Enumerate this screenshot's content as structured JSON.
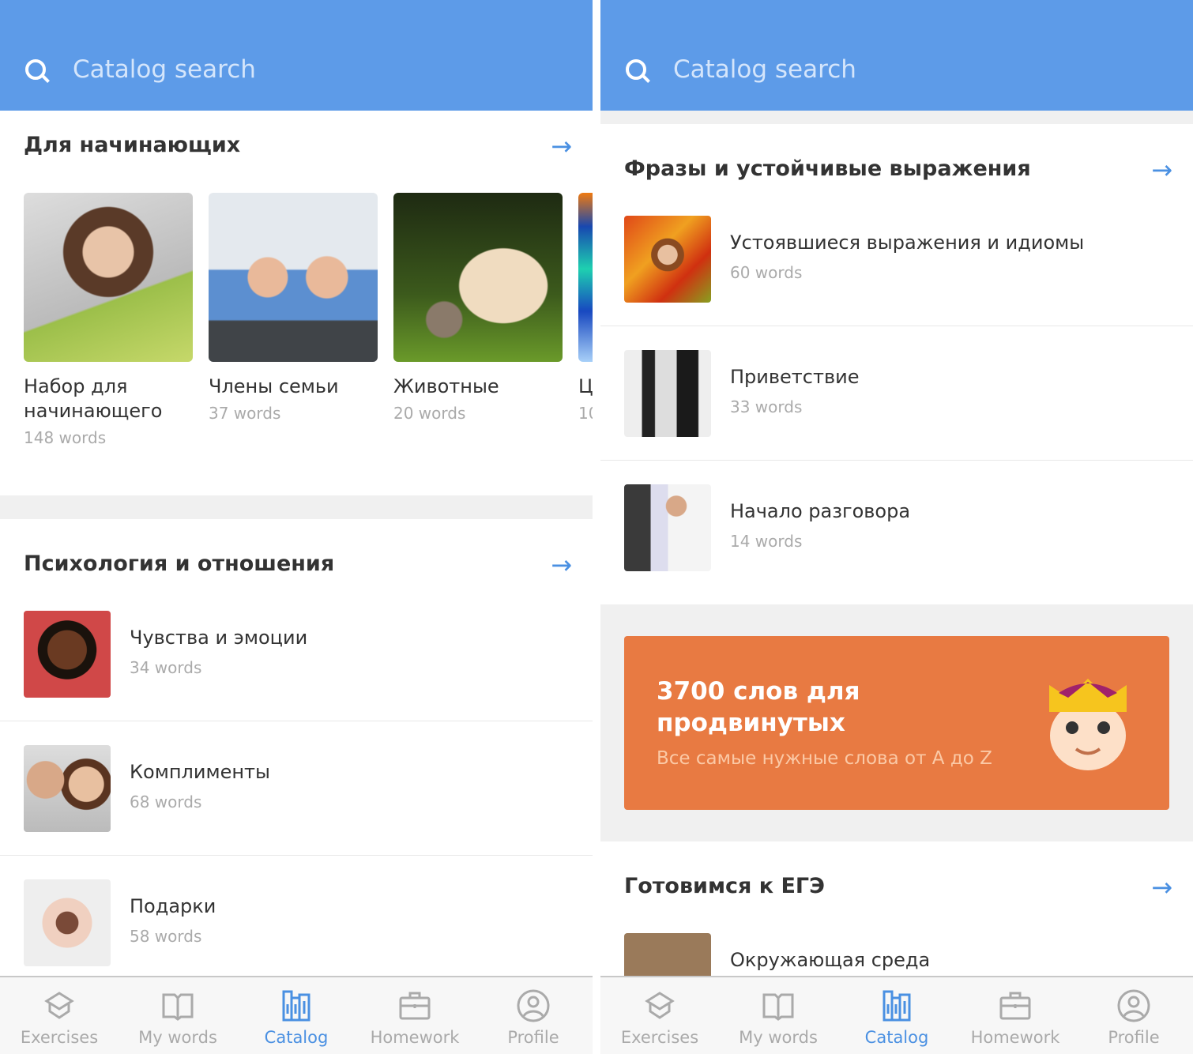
{
  "search": {
    "placeholder": "Catalog search"
  },
  "left": {
    "section1": {
      "title": "Для начинающих",
      "cards": [
        {
          "title": "Набор для начинающего",
          "count": "148 words"
        },
        {
          "title": "Члены семьи",
          "count": "37 words"
        },
        {
          "title": "Животные",
          "count": "20 words"
        },
        {
          "title": "Ц",
          "count": "10"
        }
      ]
    },
    "section2": {
      "title": "Психология и отношения",
      "items": [
        {
          "title": "Чувства и эмоции",
          "count": "34 words"
        },
        {
          "title": "Комплименты",
          "count": "68 words"
        },
        {
          "title": "Подарки",
          "count": "58 words"
        }
      ]
    }
  },
  "right": {
    "section1": {
      "title": "Фразы и устойчивые выражения",
      "items": [
        {
          "title": "Устоявшиеся выражения и идиомы",
          "count": "60 words"
        },
        {
          "title": "Приветствие",
          "count": "33 words"
        },
        {
          "title": "Начало разговора",
          "count": "14 words"
        }
      ]
    },
    "banner": {
      "title": "3700 слов для продвинутых",
      "subtitle": "Все самые нужные слова от A до Z"
    },
    "section2": {
      "title": "Готовимся к ЕГЭ",
      "items": [
        {
          "title": "Окружающая среда"
        }
      ]
    }
  },
  "nav": [
    {
      "label": "Exercises",
      "icon": "graduation-cap-icon"
    },
    {
      "label": "My words",
      "icon": "book-icon"
    },
    {
      "label": "Catalog",
      "icon": "catalog-icon",
      "active": true
    },
    {
      "label": "Homework",
      "icon": "briefcase-icon"
    },
    {
      "label": "Profile",
      "icon": "profile-icon"
    }
  ],
  "colors": {
    "header": "#5d9be8",
    "accent": "#4a90e2",
    "banner": "#e87a42"
  }
}
